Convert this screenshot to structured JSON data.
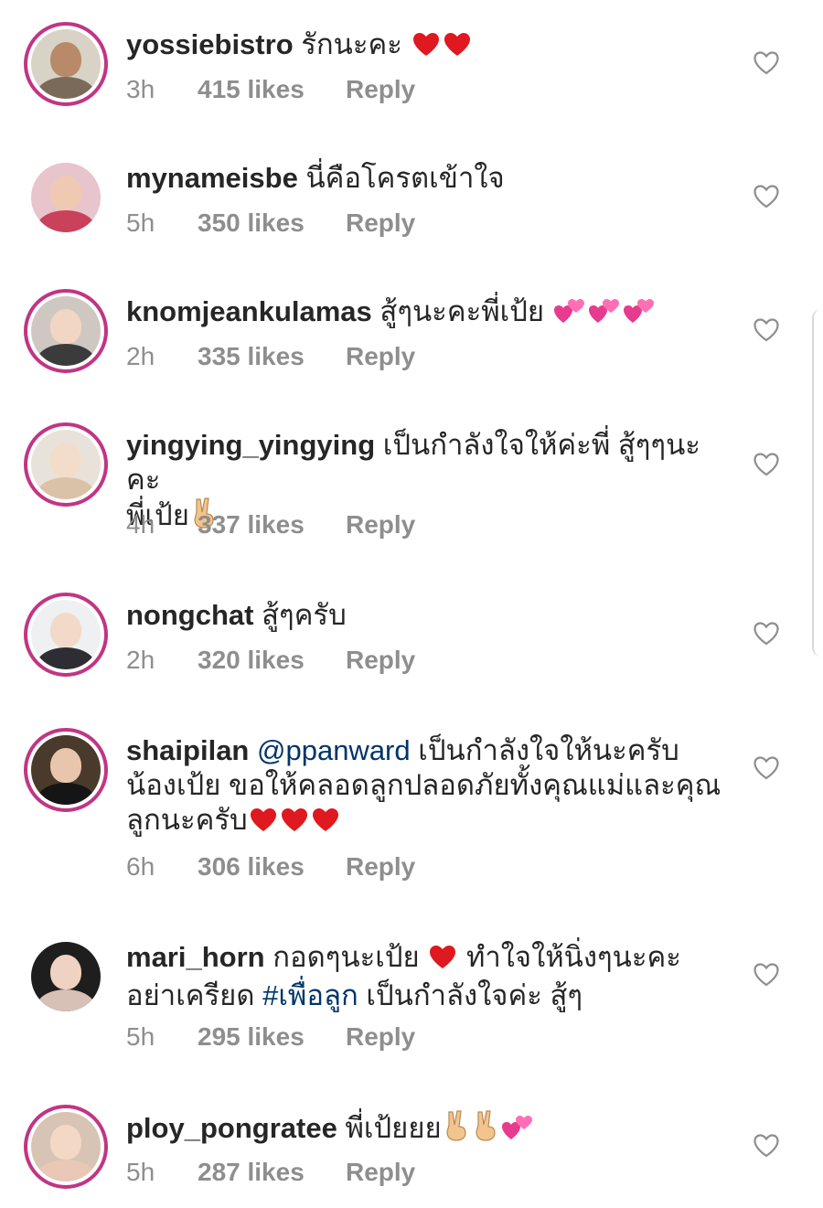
{
  "colors": {
    "username": "#262626",
    "text": "#262626",
    "meta": "#8e8e8e",
    "link": "#003569",
    "story_ring": "#c13584"
  },
  "comments": [
    {
      "username": "yossiebistro",
      "text": "รักนะคะ",
      "emoji_after": [
        "red-heart",
        "red-heart"
      ],
      "time": "3h",
      "likes": "415 likes",
      "reply": "Reply",
      "avatar": {
        "story_ring": true,
        "icon": "avatar-photo"
      }
    },
    {
      "username": "mynameisbe",
      "text": "นี่คือโครตเข้าใจ",
      "time": "5h",
      "likes": "350 likes",
      "reply": "Reply",
      "avatar": {
        "story_ring": false,
        "icon": "avatar-photo"
      }
    },
    {
      "username": "knomjeankulamas",
      "text": "สู้ๆนะคะพี่เป้ย",
      "emoji_after": [
        "two-hearts",
        "two-hearts",
        "two-hearts"
      ],
      "time": "2h",
      "likes": "335 likes",
      "reply": "Reply",
      "avatar": {
        "story_ring": true,
        "icon": "avatar-photo"
      }
    },
    {
      "username": "yingying_yingying",
      "text": "เป็นกำลังใจให้ค่ะพี่ สู้ๆๆนะคะ",
      "text_line2": "พี่เป้ย",
      "emoji_after_line2": [
        "victory-hand"
      ],
      "time": "4h",
      "likes": "337 likes",
      "reply": "Reply",
      "avatar": {
        "story_ring": true,
        "icon": "avatar-photo"
      }
    },
    {
      "username": "nongchat",
      "text": "สู้ๆครับ",
      "time": "2h",
      "likes": "320 likes",
      "reply": "Reply",
      "avatar": {
        "story_ring": true,
        "icon": "avatar-photo"
      }
    },
    {
      "username": "shaipilan",
      "mention": "@ppanward",
      "text": "เป็นกำลังใจให้นะครับ",
      "text_line2": "น้องเป้ย ขอให้คลอดลูกปลอดภัยทั้งคุณแม่และคุณ",
      "text_line3": "ลูกนะครับ",
      "emoji_after_line3": [
        "red-heart",
        "red-heart",
        "red-heart"
      ],
      "time": "6h",
      "likes": "306 likes",
      "reply": "Reply",
      "avatar": {
        "story_ring": true,
        "icon": "avatar-photo"
      }
    },
    {
      "username": "mari_horn",
      "text": "กอดๆนะเป้ย",
      "emoji_mid": [
        "red-heart"
      ],
      "text_after_emoji": "ทำใจให้นิ่งๆนะคะ",
      "text_line2_pre": "อย่าเครียด",
      "hashtag": "#เพื่อลูก",
      "text_line2_post": "เป็นกำลังใจค่ะ สู้ๆ",
      "time": "5h",
      "likes": "295 likes",
      "reply": "Reply",
      "avatar": {
        "story_ring": false,
        "icon": "avatar-photo"
      }
    },
    {
      "username": "ploy_pongratee",
      "text": "พี่เป้ยยย",
      "emoji_after": [
        "victory-hand",
        "victory-hand",
        "two-hearts"
      ],
      "time": "5h",
      "likes": "287 likes",
      "reply": "Reply",
      "avatar": {
        "story_ring": true,
        "icon": "avatar-photo"
      }
    }
  ]
}
